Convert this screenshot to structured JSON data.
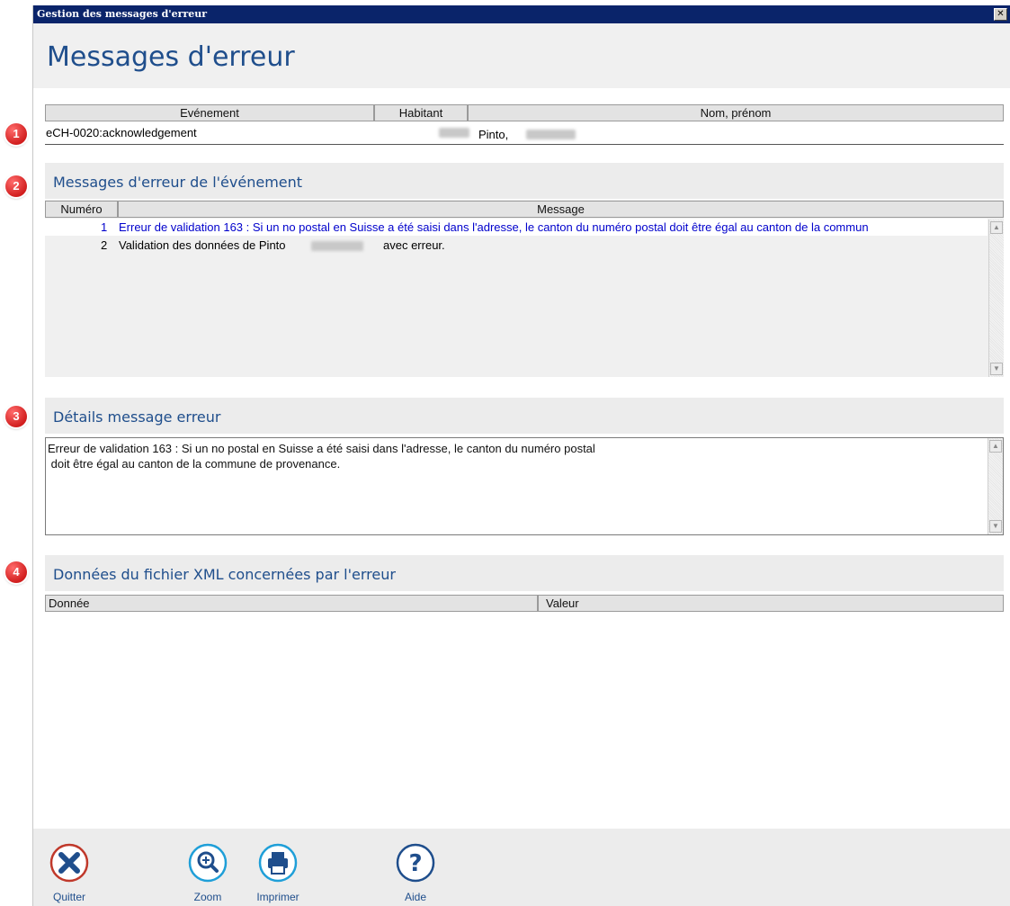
{
  "window": {
    "title": "Gestion des messages d'erreur",
    "close_glyph": "✕"
  },
  "page_title": "Messages d'erreur",
  "event_table": {
    "headers": [
      "Evénement",
      "Habitant",
      "Nom, prénom"
    ],
    "row": {
      "event": "eCH-0020:acknowledgement",
      "name": "Pinto,"
    }
  },
  "section_messages": {
    "badge": "2",
    "title": "Messages d'erreur de l'événement",
    "headers": [
      "Numéro",
      "Message"
    ],
    "rows": [
      {
        "num": "1",
        "message": "Erreur de validation 163 : Si un no postal en Suisse a été saisi dans l'adresse, le canton du numéro postal doit être égal au canton de la commun"
      },
      {
        "num": "2",
        "message_prefix": "Validation des données de Pinto",
        "message_suffix": "avec erreur."
      }
    ]
  },
  "section_details": {
    "badge": "3",
    "title": "Détails message erreur",
    "text_line1": "Erreur de validation 163 : Si un no postal en Suisse a été saisi dans l'adresse, le canton du numéro postal",
    "text_line2": " doit être égal au canton de la commune de provenance."
  },
  "section_xml": {
    "badge": "4",
    "title": "Données du fichier XML concernées par l'erreur",
    "headers": [
      "Donnée",
      "Valeur"
    ]
  },
  "badge_event": "1",
  "footer": {
    "buttons": [
      {
        "label": "Quitter",
        "icon": "close-icon"
      },
      {
        "label": "Zoom",
        "icon": "zoom-in-icon"
      },
      {
        "label": "Imprimer",
        "icon": "printer-icon"
      },
      {
        "label": "Aide",
        "icon": "help-icon"
      }
    ]
  },
  "colors": {
    "title_blue": "#1f4e8c",
    "selected_text": "#0000cc",
    "titlebar": "#0a246a",
    "badge_red": "#d21f1f",
    "quit_red": "#c0392b",
    "icon_blue": "#1f78c8"
  }
}
